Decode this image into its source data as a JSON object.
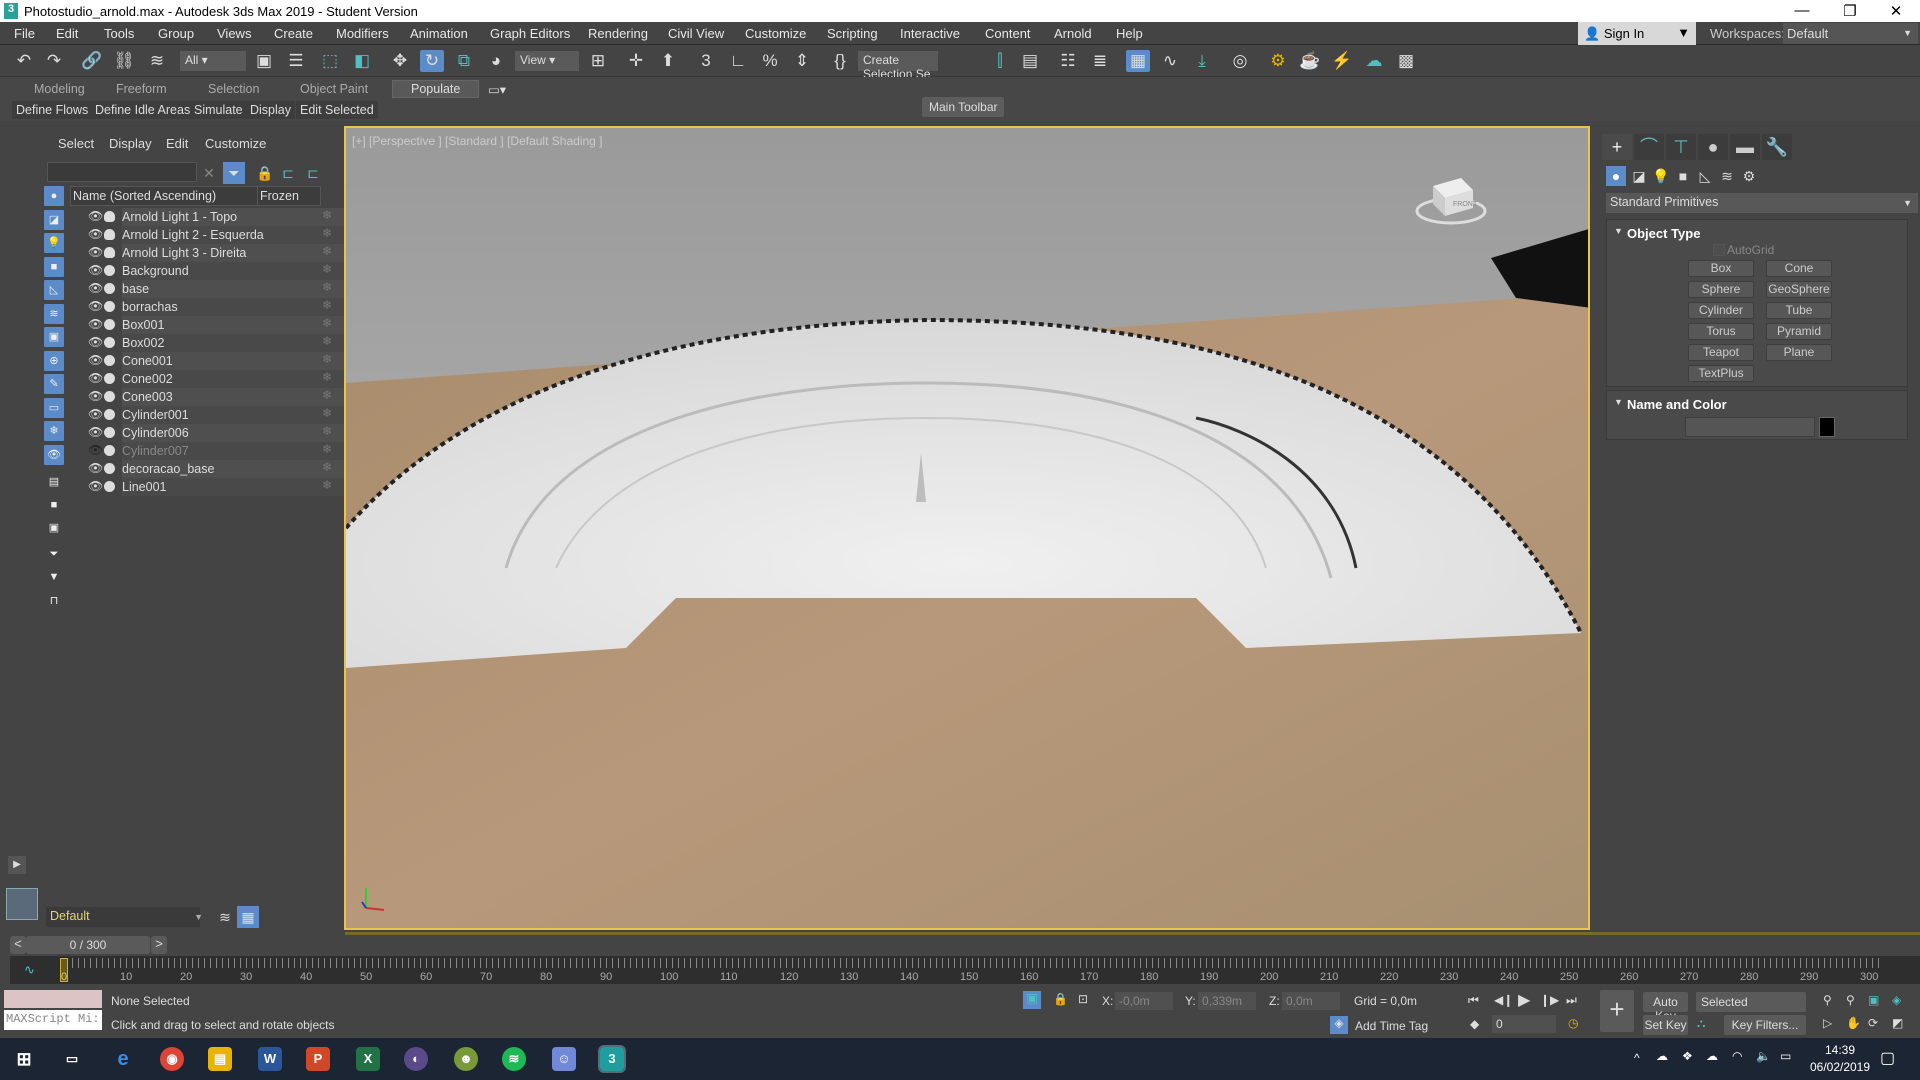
{
  "window": {
    "title": "Photostudio_arnold.max - Autodesk 3ds Max 2019 - Student Version",
    "logo": "3"
  },
  "menu": [
    "File",
    "Edit",
    "Tools",
    "Group",
    "Views",
    "Create",
    "Modifiers",
    "Animation",
    "Graph Editors",
    "Rendering",
    "Civil View",
    "Customize",
    "Scripting",
    "Interactive",
    "Content",
    "Arnold",
    "Help"
  ],
  "account": {
    "sign_in": "Sign In",
    "workspaces_label": "Workspaces:",
    "workspace": "Default"
  },
  "toolbar": {
    "filter": "All",
    "ref_coord": "View",
    "selection_set": "Create Selection Se",
    "tooltip": "Main Toolbar"
  },
  "ribbon": {
    "tabs": [
      "Modeling",
      "Freeform",
      "Selection",
      "Object Paint",
      "Populate"
    ],
    "active": "Populate",
    "sub": [
      "Define Flows",
      "Define Idle Areas",
      "Simulate",
      "Display",
      "Edit Selected"
    ]
  },
  "explorer": {
    "menu": [
      "Select",
      "Display",
      "Edit",
      "Customize"
    ],
    "col_name": "Name (Sorted Ascending)",
    "col_frozen": "Frozen",
    "items": [
      {
        "name": "Arnold Light 1 - Topo",
        "type": "light",
        "visible": true
      },
      {
        "name": "Arnold Light 2 - Esquerda",
        "type": "light",
        "visible": true
      },
      {
        "name": "Arnold Light 3 - Direita",
        "type": "light",
        "visible": true
      },
      {
        "name": "Background",
        "type": "geometry",
        "visible": true
      },
      {
        "name": "base",
        "type": "geometry",
        "visible": true
      },
      {
        "name": "borrachas",
        "type": "geometry",
        "visible": true
      },
      {
        "name": "Box001",
        "type": "geometry",
        "visible": true
      },
      {
        "name": "Box002",
        "type": "geometry",
        "visible": true
      },
      {
        "name": "Cone001",
        "type": "geometry",
        "visible": true
      },
      {
        "name": "Cone002",
        "type": "geometry",
        "visible": true
      },
      {
        "name": "Cone003",
        "type": "geometry",
        "visible": true
      },
      {
        "name": "Cylinder001",
        "type": "geometry",
        "visible": true
      },
      {
        "name": "Cylinder006",
        "type": "geometry",
        "visible": true
      },
      {
        "name": "Cylinder007",
        "type": "geometry",
        "visible": false
      },
      {
        "name": "decoracao_base",
        "type": "geometry",
        "visible": true
      },
      {
        "name": "Line001",
        "type": "geometry",
        "visible": true
      }
    ],
    "layer": "Default"
  },
  "viewport": {
    "label": "[+] [Perspective ] [Standard ] [Default Shading ]",
    "viewcube": "FRONT"
  },
  "command_panel": {
    "category": "Standard Primitives",
    "object_type_title": "Object Type",
    "autogrid": "AutoGrid",
    "buttons": [
      "Box",
      "Cone",
      "Sphere",
      "GeoSphere",
      "Cylinder",
      "Tube",
      "Torus",
      "Pyramid",
      "Teapot",
      "Plane",
      "TextPlus"
    ],
    "name_color_title": "Name and Color",
    "color": "#000000"
  },
  "timeline": {
    "frame": "0 / 300",
    "current": 0,
    "ticks": [
      "0",
      "10",
      "20",
      "30",
      "40",
      "50",
      "60",
      "70",
      "80",
      "90",
      "100",
      "110",
      "120",
      "130",
      "140",
      "150",
      "160",
      "170",
      "180",
      "190",
      "200",
      "210",
      "220",
      "230",
      "240",
      "250",
      "260",
      "270",
      "280",
      "290",
      "300"
    ]
  },
  "status": {
    "maxscript": "MAXScript Mi:",
    "selection": "None Selected",
    "prompt": "Click and drag to select and rotate objects",
    "x_label": "X:",
    "x": "-0,0m",
    "y_label": "Y:",
    "y": "0,339m",
    "z_label": "Z:",
    "z": "0,0m",
    "grid": "Grid = 0,0m",
    "add_time_tag": "Add Time Tag",
    "auto_key": "Auto Key",
    "set_key": "Set Key",
    "key_mode": "Selected",
    "key_filters": "Key Filters...",
    "frame_field": "0"
  },
  "taskbar": {
    "time": "14:39",
    "date": "06/02/2019"
  },
  "colors": {
    "accent": "#5b8bc8",
    "viewport_border": "#e8c44a",
    "teal": "#4fc0c0"
  }
}
